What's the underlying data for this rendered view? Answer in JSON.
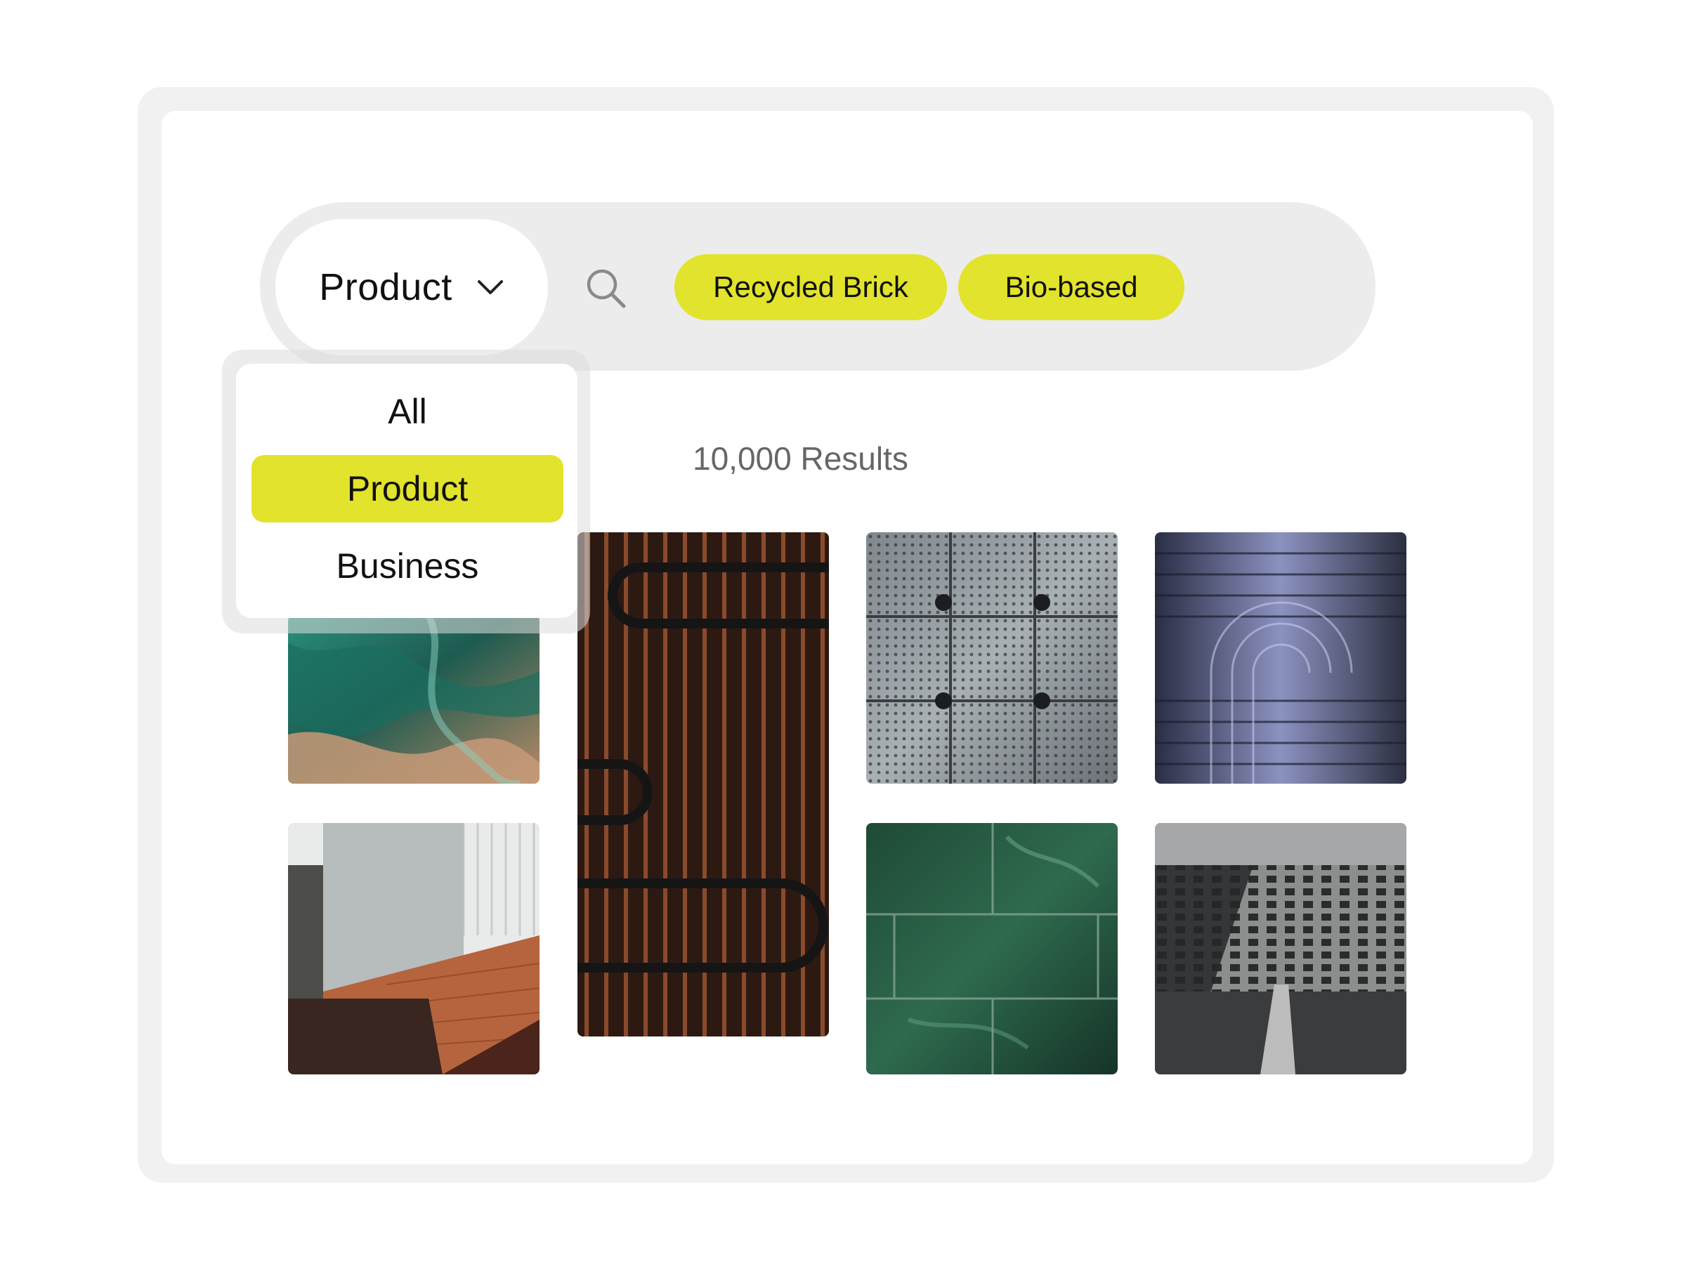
{
  "search": {
    "scope_selected": "Product",
    "chips": [
      "Recycled Brick",
      "Bio-based"
    ]
  },
  "dropdown": {
    "options": [
      "All",
      "Product",
      "Business"
    ],
    "selected": "Product"
  },
  "results": {
    "count_label": "10,000 Results"
  },
  "icons": {
    "search": "search-icon",
    "chevron": "chevron-down-icon"
  },
  "colors": {
    "accent": "#e1e32c",
    "bar": "#ececec",
    "frame": "#f1f1f1"
  },
  "gallery": {
    "tiles": [
      "green-foil-material",
      "copper-slat-wall",
      "perforated-metal-panel",
      "blue-metal-grooves",
      "brick-and-metal-facade",
      "green-marble-tiles",
      "perforated-brick-wall"
    ]
  }
}
